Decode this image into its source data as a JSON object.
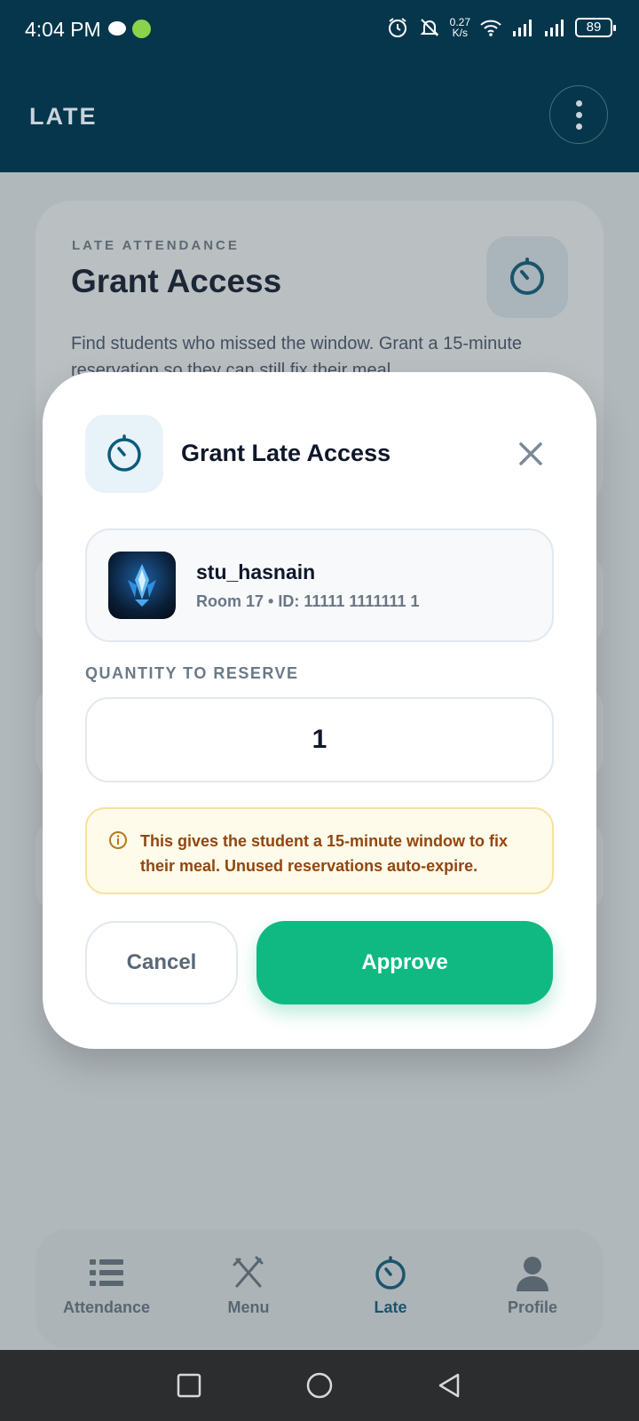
{
  "status_bar": {
    "time": "4:04 PM",
    "net_speed_value": "0.27",
    "net_speed_unit": "K/s",
    "battery": "89"
  },
  "app_bar": {
    "title": "LATE",
    "menu_icon": "more-vertical-icon"
  },
  "background_card": {
    "eyebrow": "LATE ATTENDANCE",
    "title": "Grant Access",
    "description": "Find students who missed the window. Grant a 15-minute reservation so they can still fix their meal.",
    "icon": "timer-icon"
  },
  "modal": {
    "title": "Grant Late Access",
    "icon": "timer-icon",
    "close_icon": "close-icon",
    "student": {
      "name": "stu_hasnain",
      "meta": "Room 17 • ID: 11111 1111111 1"
    },
    "quantity_label": "QUANTITY TO RESERVE",
    "quantity_value": "1",
    "notice": "This gives the student a 15-minute window to fix their meal. Unused reservations auto-expire.",
    "cancel_label": "Cancel",
    "approve_label": "Approve"
  },
  "bottom_nav": {
    "items": [
      {
        "label": "Attendance",
        "icon": "list-icon",
        "active": false
      },
      {
        "label": "Menu",
        "icon": "utensils-icon",
        "active": false
      },
      {
        "label": "Late",
        "icon": "timer-icon",
        "active": true
      },
      {
        "label": "Profile",
        "icon": "user-icon",
        "active": false
      }
    ]
  },
  "colors": {
    "app_bar": "#05364c",
    "approve": "#10b981",
    "notice_bg": "#fefbea",
    "notice_text": "#92460f",
    "active_nav": "#0c5b7a"
  }
}
